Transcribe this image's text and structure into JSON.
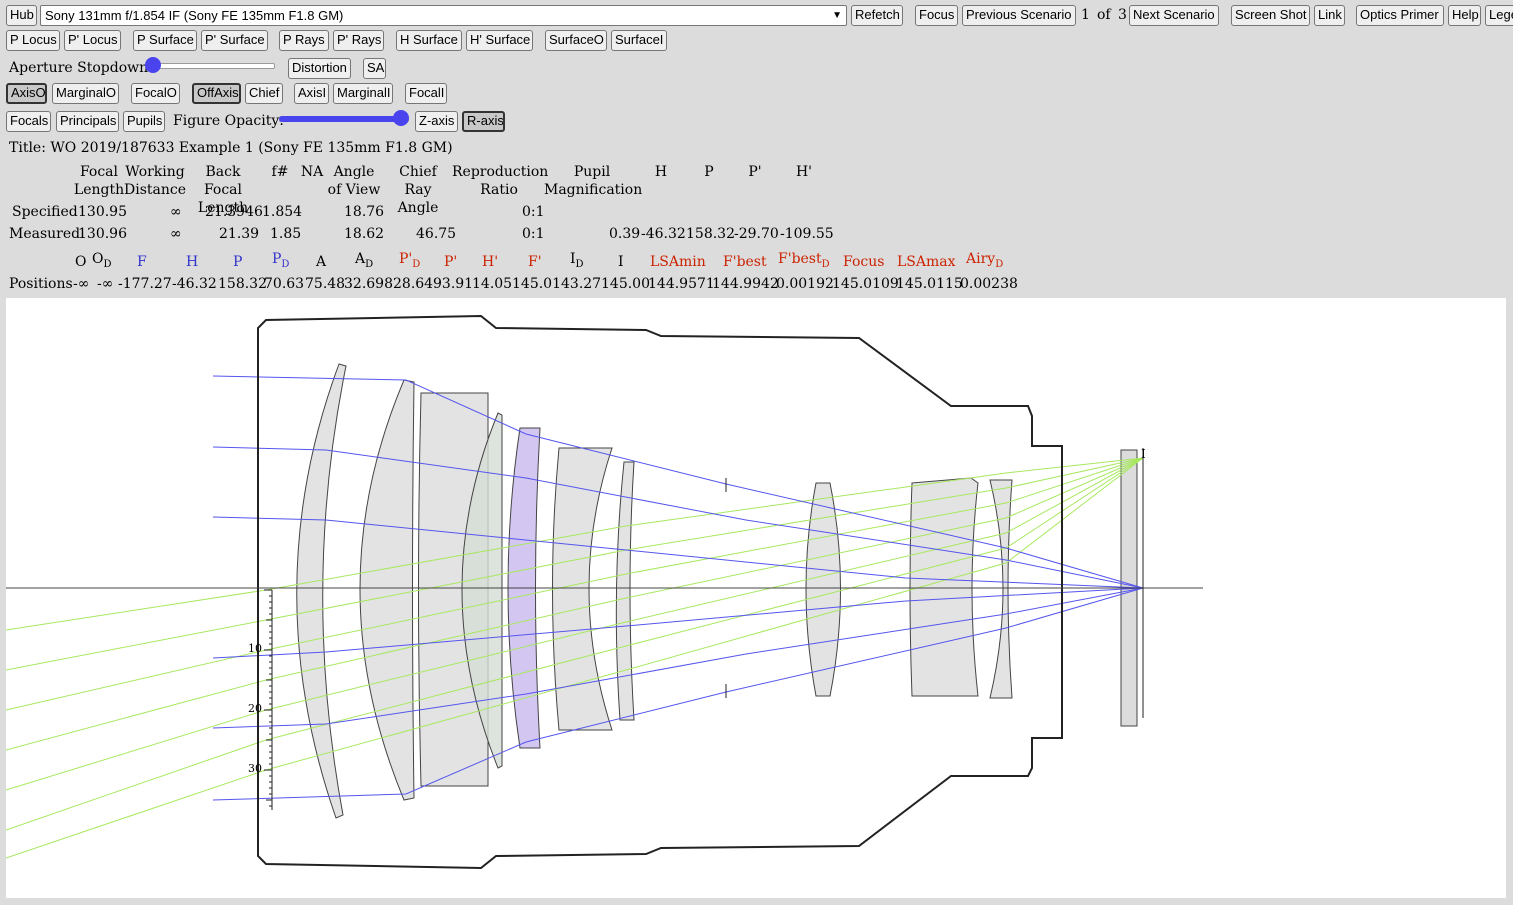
{
  "toolbar1": {
    "hub": "Hub",
    "lens_select": "Sony 131mm f/1.854 IF (Sony FE 135mm F1.8 GM)",
    "refetch": "Refetch",
    "focus": "Focus",
    "previous_scenario": "Previous Scenario",
    "scenario_current": "1",
    "scenario_of": "of",
    "scenario_total": "3",
    "next_scenario": "Next Scenario",
    "screen_shot": "Screen Shot",
    "link": "Link",
    "optics_primer": "Optics Primer",
    "help": "Help",
    "legend": "Lege"
  },
  "toolbar2": {
    "p_locus": "P Locus",
    "p_prime_locus": "P' Locus",
    "p_surface": "P Surface",
    "p_prime_surface": "P' Surface",
    "p_rays": "P Rays",
    "p_prime_rays": "P' Rays",
    "h_surface": "H Surface",
    "h_prime_surface": "H' Surface",
    "surface_o": "SurfaceO",
    "surface_i": "SurfaceI"
  },
  "toolbar3": {
    "aperture_label": "Aperture Stopdown:",
    "aperture_value_fraction": 0.0,
    "distortion": "Distortion",
    "sa": "SA"
  },
  "toolbar4": {
    "axis_o": "AxisO",
    "marginal_o": "MarginalO",
    "focal_o": "FocalO",
    "off_axis": "OffAxis",
    "chief": "Chief",
    "axis_i": "AxisI",
    "marginal_i": "MarginalI",
    "focal_i": "FocalI"
  },
  "toolbar5": {
    "focals": "Focals",
    "principals": "Principals",
    "pupils": "Pupils",
    "opacity_label": "Figure Opacity:",
    "opacity_value_fraction": 1.0,
    "z_axis": "Z-axis",
    "r_axis": "R-axis"
  },
  "title": "Title: WO 2019/187633 Example 1 (Sony FE 135mm F1.8 GM)",
  "table": {
    "headers": [
      {
        "l1": "Focal",
        "l2": "Length"
      },
      {
        "l1": "Working",
        "l2": "Distance"
      },
      {
        "l1": "Back Focal",
        "l2": "Length"
      },
      {
        "l1": "",
        "l2": "f#"
      },
      {
        "l1": "",
        "l2": "NA"
      },
      {
        "l1": "Angle",
        "l2": "of View"
      },
      {
        "l1": "Chief",
        "l2": "Ray Angle"
      },
      {
        "l1": "Reproduction",
        "l2": "Ratio"
      },
      {
        "l1": "Pupil",
        "l2": "Magnification"
      },
      {
        "l1": "",
        "l2": "H"
      },
      {
        "l1": "",
        "l2": "P"
      },
      {
        "l1": "",
        "l2": "P'"
      },
      {
        "l1": "",
        "l2": "H'"
      }
    ],
    "specified": {
      "label": "Specified",
      "focal_length": "130.95",
      "working_distance": "∞",
      "bfl": "21.3946",
      "f_number": "1.854",
      "angle_of_view": "18.76",
      "reproduction_ratio": "0:1"
    },
    "measured": {
      "label": "Measured",
      "focal_length": "130.96",
      "working_distance": "∞",
      "bfl": "21.39",
      "f_number": "1.85",
      "angle_of_view": "18.62",
      "chief_ray_angle": "46.75",
      "reproduction_ratio": "0:1",
      "pupil_mag": "0.39",
      "h": "-46.32",
      "p": "158.32",
      "p_prime": "-29.70",
      "h_prime": "-109.55"
    }
  },
  "positions": {
    "labels": [
      {
        "main": "O",
        "sub": "",
        "color": "black"
      },
      {
        "main": "O",
        "sub": "D",
        "color": "black"
      },
      {
        "main": "F",
        "sub": "",
        "color": "blue"
      },
      {
        "main": "H",
        "sub": "",
        "color": "blue"
      },
      {
        "main": "P",
        "sub": "",
        "color": "blue"
      },
      {
        "main": "P",
        "sub": "D",
        "color": "blue"
      },
      {
        "main": "A",
        "sub": "",
        "color": "black"
      },
      {
        "main": "A",
        "sub": "D",
        "color": "black"
      },
      {
        "main": "P'",
        "sub": "D",
        "color": "red"
      },
      {
        "main": "P'",
        "sub": "",
        "color": "red"
      },
      {
        "main": "H'",
        "sub": "",
        "color": "red"
      },
      {
        "main": "F'",
        "sub": "",
        "color": "red"
      },
      {
        "main": "I",
        "sub": "D",
        "color": "black"
      },
      {
        "main": "I",
        "sub": "",
        "color": "black"
      },
      {
        "main": "LSAmin",
        "sub": "",
        "color": "red"
      },
      {
        "main": "F'best",
        "sub": "",
        "color": "red"
      },
      {
        "main": "F'best",
        "sub": "D",
        "color": "red"
      },
      {
        "main": "Focus",
        "sub": "",
        "color": "red"
      },
      {
        "main": "LSAmax",
        "sub": "",
        "color": "red"
      },
      {
        "main": "Airy",
        "sub": "D",
        "color": "red"
      }
    ],
    "row_label": "Positions",
    "values": [
      "-∞",
      "-∞",
      "-177.27",
      "-46.32",
      "158.32",
      "70.63",
      "75.48",
      "32.698",
      "28.64",
      "93.91",
      "14.05",
      "145.01",
      "43.27",
      "145.00",
      "144.9571",
      "144.9942",
      "0.00192",
      "145.0109",
      "145.0115",
      "0.00238"
    ]
  },
  "diagram": {
    "scale_ticks": [
      "10",
      "20",
      "30"
    ],
    "image_label": "I",
    "colors": {
      "rays_axial": "#5555ee",
      "rays_offaxis": "#a8e860",
      "lens_fill": "#dcdcdc",
      "lens_highlight": "#c8b8ee",
      "outline": "#222222"
    }
  }
}
